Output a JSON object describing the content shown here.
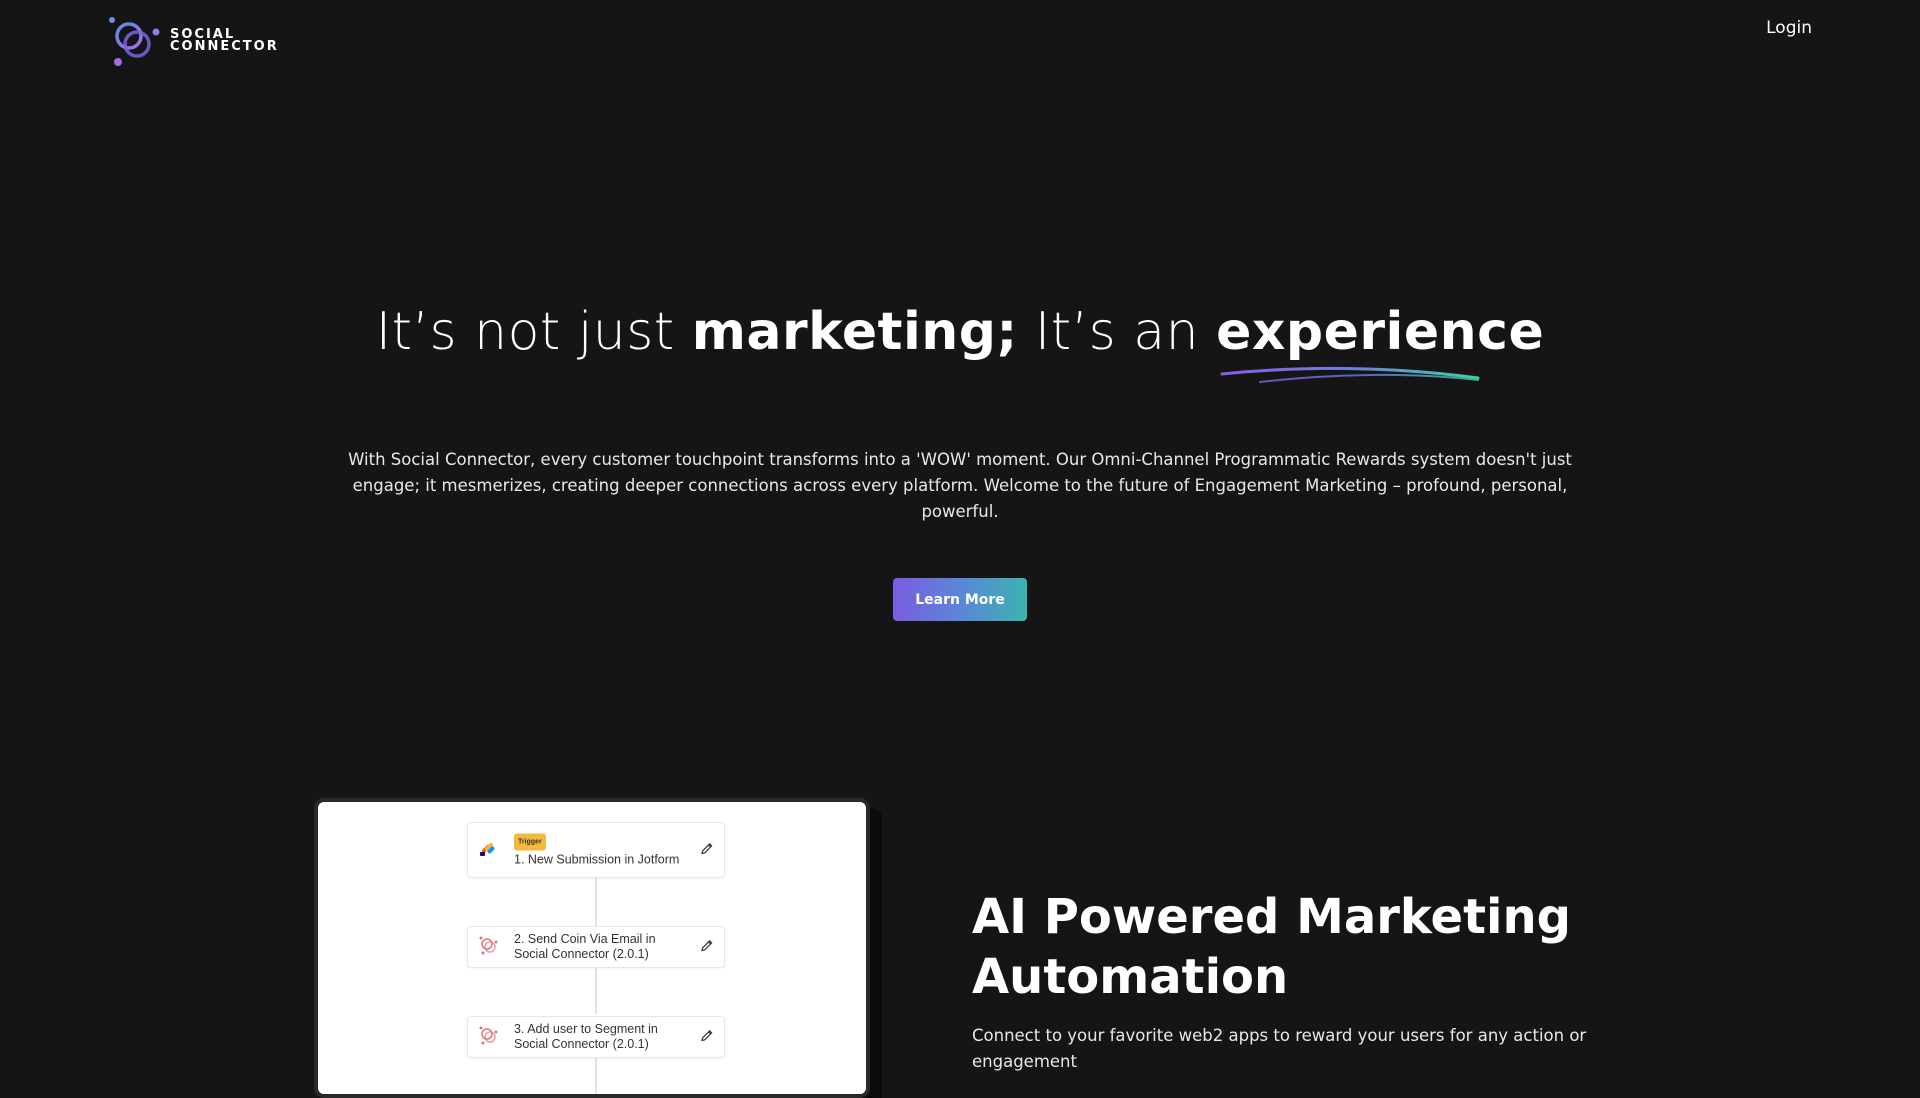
{
  "header": {
    "logo_line1": "SOCIAL",
    "logo_line2": "CONNECTOR",
    "login_label": "Login"
  },
  "hero": {
    "title_part1": "It’s not just ",
    "title_bold1": "marketing;",
    "title_part2": " It’s an ",
    "title_bold2": "experience",
    "description": "With Social Connector, every customer touchpoint transforms into a 'WOW' moment. Our Omni-Channel Programmatic Rewards system doesn't just engage; it mesmerizes, creating deeper connections across every platform. Welcome to the future of Engagement Marketing – profound, personal, powerful.",
    "cta_label": "Learn More"
  },
  "workflow": {
    "steps": [
      {
        "badge": "Trigger",
        "label": "1. New Submission in Jotform",
        "icon": "jotform-icon"
      },
      {
        "label": "2. Send Coin Via Email in Social Connector (2.0.1)",
        "icon": "social-connector-icon"
      },
      {
        "label": "3. Add user to Segment in Social Connector (2.0.1)",
        "icon": "social-connector-icon"
      }
    ]
  },
  "feature": {
    "title": "AI Powered Marketing Automation",
    "subtitle": "Connect to your favorite web2 apps to reward your users for any action or engagement"
  },
  "colors": {
    "background": "#151515",
    "button_gradient_start": "#7a5de0",
    "button_gradient_end": "#3cb3b0",
    "trigger_badge": "#f5b83d"
  }
}
